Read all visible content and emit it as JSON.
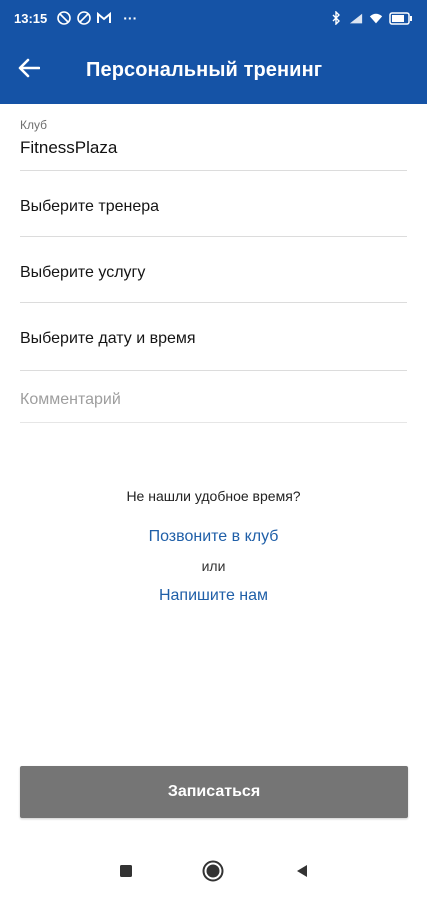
{
  "status_bar": {
    "time": "13:15",
    "left_icons": [
      "no-mic-icon",
      "no-sync-icon",
      "gmail-icon",
      "more-dots-icon"
    ],
    "more": "···",
    "right_icons": [
      "bluetooth-icon",
      "signal-icon",
      "wifi-icon",
      "battery-icon"
    ]
  },
  "app_bar": {
    "title": "Персональный тренинг",
    "back_icon": "arrow-left-icon",
    "background": "#1553a6"
  },
  "form": {
    "club": {
      "label": "Клуб",
      "value": "FitnessPlaza"
    },
    "trainer": {
      "label": "Выберите тренера"
    },
    "service": {
      "label": "Выберите услугу"
    },
    "datetime": {
      "label": "Выберите дату и время"
    },
    "comment": {
      "placeholder": "Комментарий",
      "value": ""
    }
  },
  "help": {
    "question": "Не нашли удобное время?",
    "call_link": "Позвоните в клуб",
    "or": "или",
    "write_link": "Напишите нам",
    "link_color": "#1f5fa8"
  },
  "submit": {
    "label": "Записаться",
    "background": "#757575"
  },
  "nav_bar": {
    "buttons": [
      "recent-apps-icon",
      "home-icon",
      "back-triangle-icon"
    ]
  }
}
